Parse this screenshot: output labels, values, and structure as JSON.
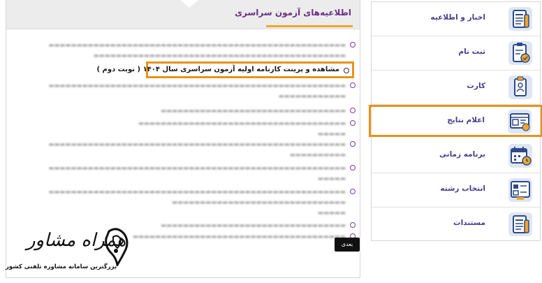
{
  "announcements": {
    "title": "اطلاعیه‌های آزمون سراسری",
    "highlighted_item": "مشاهده و پرینت کارنامه اولیه آزمون سراسری سال ۱۴۰۴ ( نوبت دوم )",
    "next_label": "بعدی"
  },
  "logo": {
    "name": "همراه مشاور",
    "tagline": "بزرگترین سامانه مشاوره تلفنی کشور"
  },
  "sidebar": {
    "items": [
      {
        "label": "اخبار و اطلاعیه",
        "icon": "newspaper-icon"
      },
      {
        "label": "ثبت نام",
        "icon": "clipboard-check-icon"
      },
      {
        "label": "کارت",
        "icon": "id-card-icon"
      },
      {
        "label": "اعلام نتایج",
        "icon": "results-board-icon"
      },
      {
        "label": "برنامه زمانی",
        "icon": "calendar-icon"
      },
      {
        "label": "انتخاب رشته",
        "icon": "selection-board-icon"
      },
      {
        "label": "مستندات",
        "icon": "documents-icon"
      }
    ]
  },
  "colors": {
    "accent_purple": "#6c2f86",
    "highlight_orange": "#e8921b",
    "header_gray": "#ececec",
    "icon_blue": "#2c4a8a",
    "icon_orange": "#f0a62a"
  }
}
